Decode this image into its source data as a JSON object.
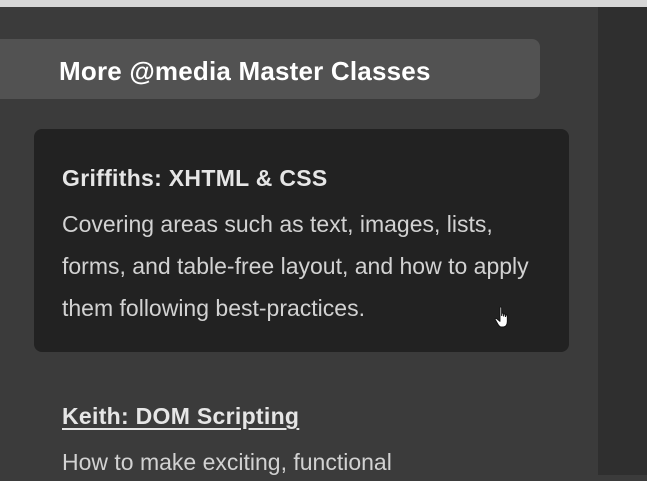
{
  "sidebar": {
    "heading": "More @media Master Classes",
    "items": [
      {
        "title": "Griffiths: XHTML & CSS",
        "description": "Covering areas such as text, images, lists, forms, and table-free layout, and how to apply them following best-practices.",
        "state": "hovered"
      },
      {
        "title": "Keith: DOM Scripting",
        "description": "How to make exciting, functional",
        "state": "default"
      }
    ]
  },
  "cursor": {
    "icon": "hand-pointer-icon"
  },
  "colors": {
    "background": "#3b3b3b",
    "header_bg": "#525252",
    "card_hover_bg": "#222222",
    "side_column": "#2f2f2f",
    "text": "#d2d2d2"
  }
}
